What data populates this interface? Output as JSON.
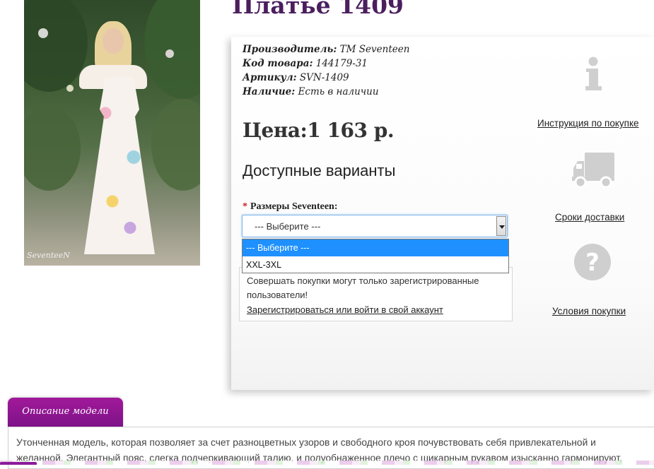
{
  "product": {
    "title": "Платье 1409",
    "photo_watermark": "SeventeeN"
  },
  "info": [
    {
      "key": "Производитель:",
      "value": " ТМ Seventeen"
    },
    {
      "key": "Код товара:",
      "value": " 144179-31"
    },
    {
      "key": "Артикул:",
      "value": " SVN-1409"
    },
    {
      "key": "Наличие:",
      "value": " Есть в наличии"
    }
  ],
  "price": {
    "label": "Цена:",
    "value": "1 163 р."
  },
  "options": {
    "title": "Доступные варианты",
    "size_label": "Размеры Seventeen:",
    "required_mark": "*",
    "selected": "--- Выберите ---",
    "dropdown_options": [
      "--- Выберите ---",
      "XXL-3XL"
    ]
  },
  "notice": {
    "message": "Совершать покупки могут только зарегистрированные пользователи!",
    "login_link": "Зарегистрироваться или войти в свой аккаунт"
  },
  "sidebar": {
    "instruction": {
      "label": "Инструкция по покупке",
      "icon": "info-icon"
    },
    "delivery": {
      "label": "Сроки доставки",
      "icon": "truck-icon"
    },
    "terms": {
      "label": "Условия покупки",
      "icon": "question-icon"
    }
  },
  "description": {
    "tab_label": "Описание модели",
    "text": "Утонченная модель, которая позволяет за счет разноцветных узоров и свободного кроя почувствовать себя привлекательной и желанной. Элегантный пояс, слегка подчеркивающий талию, и полуобнаженное плечо с шикарным рукавом изысканно гармонируют,"
  },
  "colors": {
    "title": "#4b1f5e",
    "tab": "#8d1691",
    "select_highlight": "#1e90ff",
    "icon_gray": "#cfcfcf"
  }
}
